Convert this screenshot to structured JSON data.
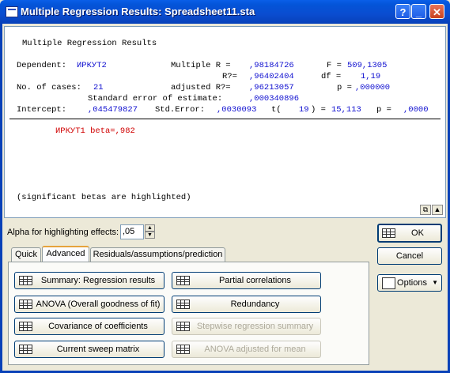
{
  "window": {
    "title": "Multiple Regression Results: Spreadsheet11.sta",
    "help_label": "?",
    "minimize_label": "_",
    "close_label": "✕"
  },
  "results": {
    "heading": "Multiple Regression Results",
    "dependent_label": "Dependent:",
    "dependent_value": "ИРКУТ2",
    "multiple_r_label": "Multiple R =",
    "multiple_r_value": ",98184726",
    "f_label": "F =",
    "f_value": "509,1305",
    "r2_label": "R?=",
    "r2_value": ",96402404",
    "df_label": "df =",
    "df_value": "1,19",
    "cases_label": "No. of cases:",
    "cases_value": "21",
    "adj_r2_label": "adjusted R?=",
    "adj_r2_value": ",96213057",
    "p_label": "p =",
    "p_value": ",000000",
    "std_err_est_label": "Standard error of estimate:",
    "std_err_est_value": ",000340896",
    "intercept_label": "Intercept:",
    "intercept_value": ",045479827",
    "std_error_label": "Std.Error:",
    "std_error_value": ",0030093",
    "t_label": "t(",
    "t_df": "19",
    "t_eq": ") =",
    "t_value": "15,113",
    "p2_label": "p =",
    "p2_value": ",0000",
    "beta_line": "ИРКУТ1 beta=,982",
    "note": "(significant betas are highlighted)"
  },
  "alpha": {
    "label": "Alpha for highlighting effects:",
    "value": ",05"
  },
  "tabs": [
    {
      "label": "Quick"
    },
    {
      "label": "Advanced"
    },
    {
      "label": "Residuals/assumptions/prediction"
    }
  ],
  "buttons": {
    "summary": "Summary:  Regression results",
    "anova": "ANOVA (Overall goodness of fit)",
    "covariance": "Covariance of coefficients",
    "sweep": "Current sweep matrix",
    "partial": "Partial correlations",
    "redundancy": "Redundancy",
    "stepwise": "Stepwise regression summary",
    "anova_adj": "ANOVA adjusted for mean",
    "ok": "OK",
    "cancel": "Cancel",
    "options": "Options"
  }
}
